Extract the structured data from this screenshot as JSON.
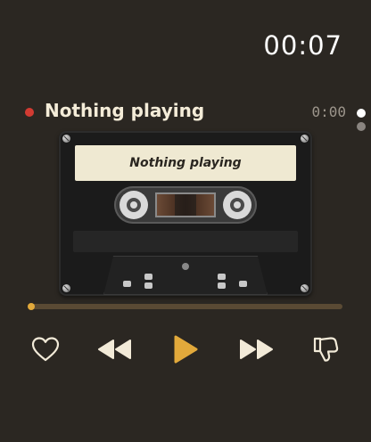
{
  "status": {
    "clock": "00:07"
  },
  "track": {
    "title": "Nothing playing",
    "elapsed": "0:00",
    "recording": true
  },
  "pager": {
    "pages": 2,
    "active_index": 0
  },
  "cassette": {
    "label": "Nothing playing"
  },
  "progress": {
    "fraction": 0.0
  },
  "controls": {
    "like_icon": "heart-icon",
    "rewind_icon": "rewind-icon",
    "play_icon": "play-icon",
    "forward_icon": "fast-forward-icon",
    "dislike_icon": "thumbs-down-icon"
  },
  "colors": {
    "background": "#2b2722",
    "accent": "#e2a93b",
    "record": "#d23b32",
    "text": "#f4ecd8",
    "track": "#5a4a34"
  }
}
